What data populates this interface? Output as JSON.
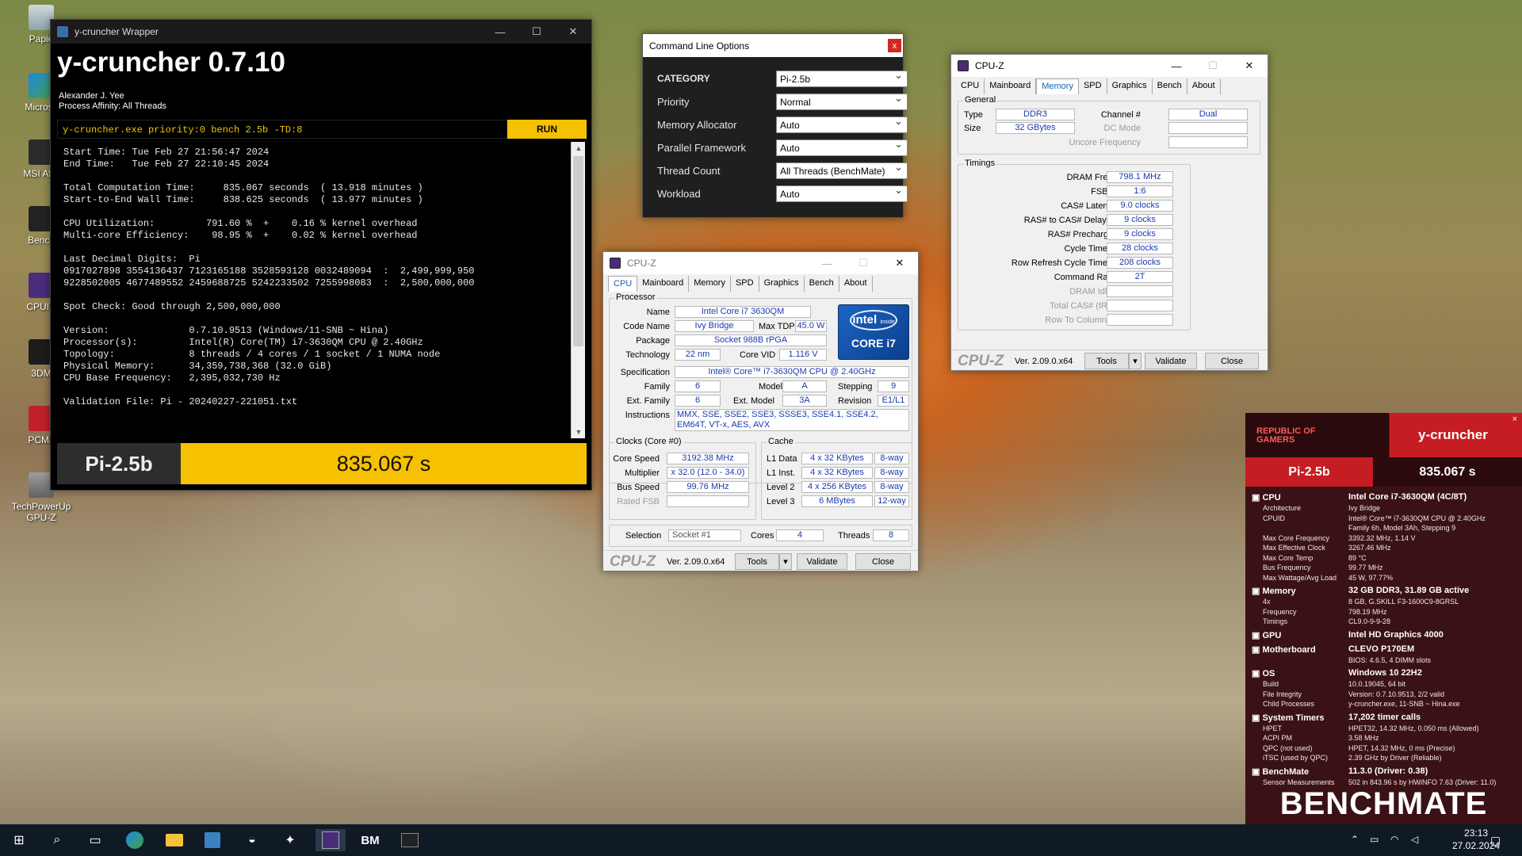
{
  "desktop": {
    "icons": [
      {
        "label": "Papie"
      },
      {
        "label": "Microsc"
      },
      {
        "label": "MSI Afte"
      },
      {
        "label": "Bench"
      },
      {
        "label": "CPUID"
      },
      {
        "label": "3DM"
      },
      {
        "label": "PCMa"
      },
      {
        "label": "TechPowerUp GPU-Z"
      }
    ]
  },
  "ycruncher": {
    "window_title": "y-cruncher Wrapper",
    "title": "y-cruncher 0.7.10",
    "author": "Alexander J. Yee",
    "affinity": "Process Affinity: All Threads",
    "command": "y-cruncher.exe priority:0 bench 2.5b -TD:8",
    "run_label": "RUN",
    "output": [
      "Start Time: Tue Feb 27 21:56:47 2024",
      "End Time:   Tue Feb 27 22:10:45 2024",
      "",
      "Total Computation Time:     835.067 seconds  ( 13.918 minutes )",
      "Start-to-End Wall Time:     838.625 seconds  ( 13.977 minutes )",
      "",
      "CPU Utilization:         791.60 %  +    0.16 % kernel overhead",
      "Multi-core Efficiency:    98.95 %  +    0.02 % kernel overhead",
      "",
      "Last Decimal Digits:  Pi",
      "0917027898 3554136437 7123165188 3528593128 0032489094  :  2,499,999,950",
      "9228502005 4677489552 2459688725 5242233502 7255998083  :  2,500,000,000",
      "",
      "Spot Check: Good through 2,500,000,000",
      "",
      "Version:              0.7.10.9513 (Windows/11-SNB ~ Hina)",
      "Processor(s):         Intel(R) Core(TM) i7-3630QM CPU @ 2.40GHz",
      "Topology:             8 threads / 4 cores / 1 socket / 1 NUMA node",
      "Physical Memory:      34,359,738,368 (32.0 GiB)",
      "CPU Base Frequency:   2,395,032,730 Hz",
      "",
      "Validation File: Pi - 20240227-221051.txt"
    ],
    "result_label": "Pi-2.5b",
    "result_value": "835.067 s"
  },
  "clo": {
    "title": "Command Line Options",
    "rows": [
      {
        "label": "CATEGORY",
        "value": "Pi-2.5b"
      },
      {
        "label": "Priority",
        "value": "Normal"
      },
      {
        "label": "Memory Allocator",
        "value": "Auto"
      },
      {
        "label": "Parallel Framework",
        "value": "Auto"
      },
      {
        "label": "Thread Count",
        "value": "All Threads (BenchMate)"
      },
      {
        "label": "Workload",
        "value": "Auto"
      }
    ]
  },
  "cpuz_common": {
    "title": "CPU-Z",
    "tabs": [
      "CPU",
      "Mainboard",
      "Memory",
      "SPD",
      "Graphics",
      "Bench",
      "About"
    ],
    "logo": "CPU-Z",
    "version": "Ver. 2.09.0.x64",
    "tools": "Tools",
    "validate": "Validate",
    "close": "Close"
  },
  "cpuz_cpu": {
    "processor_group": "Processor",
    "name_label": "Name",
    "name": "Intel Core i7 3630QM",
    "codename_label": "Code Name",
    "codename": "Ivy Bridge",
    "maxtdp_label": "Max TDP",
    "maxtdp": "45.0 W",
    "package_label": "Package",
    "package": "Socket 988B rPGA",
    "tech_label": "Technology",
    "tech": "22 nm",
    "vid_label": "Core VID",
    "vid": "1.116 V",
    "spec_label": "Specification",
    "spec": "Intel® Core™ i7-3630QM CPU @ 2.40GHz",
    "family_label": "Family",
    "family": "6",
    "model_label": "Model",
    "model": "A",
    "stepping_label": "Stepping",
    "stepping": "9",
    "extfamily_label": "Ext. Family",
    "extfamily": "6",
    "extmodel_label": "Ext. Model",
    "extmodel": "3A",
    "revision_label": "Revision",
    "revision": "E1/L1",
    "instr_label": "Instructions",
    "instructions": "MMX, SSE, SSE2, SSE3, SSSE3, SSE4.1, SSE4.2, EM64T, VT-x, AES, AVX",
    "intel_inside": "intel",
    "intel_inside2": "inside",
    "core_i7": "CORE i7",
    "clocks_group": "Clocks (Core #0)",
    "corespeed_label": "Core Speed",
    "corespeed": "3192.38 MHz",
    "mult_label": "Multiplier",
    "mult": "x 32.0 (12.0 - 34.0)",
    "bus_label": "Bus Speed",
    "bus": "99.76 MHz",
    "fsb_label": "Rated FSB",
    "fsb": "",
    "cache_group": "Cache",
    "l1d_label": "L1 Data",
    "l1d": "4 x 32 KBytes",
    "l1d_way": "8-way",
    "l1i_label": "L1 Inst.",
    "l1i": "4 x 32 KBytes",
    "l1i_way": "8-way",
    "l2_label": "Level 2",
    "l2": "4 x 256 KBytes",
    "l2_way": "8-way",
    "l3_label": "Level 3",
    "l3": "6 MBytes",
    "l3_way": "12-way",
    "selection_label": "Selection",
    "selection": "Socket #1",
    "cores_label": "Cores",
    "cores": "4",
    "threads_label": "Threads",
    "threads": "8"
  },
  "cpuz_mem": {
    "general_group": "General",
    "type_label": "Type",
    "type": "DDR3",
    "size_label": "Size",
    "size": "32 GBytes",
    "channel_label": "Channel #",
    "channel": "Dual",
    "dcmode_label": "DC Mode",
    "uncore_label": "Uncore Frequency",
    "timings_group": "Timings",
    "timings": [
      {
        "label": "DRAM Frequency",
        "value": "798.1 MHz"
      },
      {
        "label": "FSB:DRAM",
        "value": "1:6"
      },
      {
        "label": "CAS# Latency (CL)",
        "value": "9.0 clocks"
      },
      {
        "label": "RAS# to CAS# Delay (tRCD)",
        "value": "9 clocks"
      },
      {
        "label": "RAS# Precharge (tRP)",
        "value": "9 clocks"
      },
      {
        "label": "Cycle Time (tRAS)",
        "value": "28 clocks"
      },
      {
        "label": "Row Refresh Cycle Time (tRFC)",
        "value": "208 clocks"
      },
      {
        "label": "Command Rate (CR)",
        "value": "2T"
      }
    ],
    "dim_timings": [
      "DRAM Idle Timer",
      "Total CAS# (tRDRAM)",
      "Row To Column (tRCD)"
    ]
  },
  "benchmate": {
    "rog": "REPUBLIC OF",
    "rog2": "GAMERS",
    "app": "y-cruncher",
    "close": "×",
    "result_label": "Pi-2.5b",
    "result_value": "835.067 s",
    "sections": [
      {
        "title": "CPU",
        "value": "Intel Core i7-3630QM (4C/8T)",
        "rows": [
          {
            "k": "Architecture",
            "v": "Ivy Bridge"
          },
          {
            "k": "CPUID",
            "v": "Intel® Core™ i7-3630QM CPU @ 2.40GHz"
          },
          {
            "k": "",
            "v": "Family 6h, Model 3Ah, Stepping 9"
          },
          {
            "k": "Max Core Frequency",
            "v": "3392.32 MHz, 1.14 V"
          },
          {
            "k": "Max Effective Clock",
            "v": "3267.46 MHz"
          },
          {
            "k": "Max Core Temp",
            "v": "89 °C"
          },
          {
            "k": "Bus Frequency",
            "v": "99.77 MHz"
          },
          {
            "k": "Max Wattage/Avg Load",
            "v": "45 W, 97.77%"
          }
        ]
      },
      {
        "title": "Memory",
        "value": "32 GB DDR3, 31.89 GB active",
        "rows": [
          {
            "k": "4x",
            "v": "8 GB, G.SKILL F3-1600C9-8GRSL"
          },
          {
            "k": "Frequency",
            "v": "798.19 MHz"
          },
          {
            "k": "Timings",
            "v": "CL9.0-9-9-28"
          }
        ]
      },
      {
        "title": "GPU",
        "value": "Intel HD Graphics 4000",
        "rows": []
      },
      {
        "title": "Motherboard",
        "value": "CLEVO P170EM",
        "rows": [
          {
            "k": "",
            "v": "BIOS: 4.6.5, 4 DIMM slots"
          }
        ]
      },
      {
        "title": "OS",
        "value": "Windows 10 22H2",
        "rows": [
          {
            "k": "Build",
            "v": "10.0.19045, 64 bit"
          },
          {
            "k": "File Integrity",
            "v": "Version: 0.7.10.9513, 2/2 valid"
          },
          {
            "k": "Child Processes",
            "v": "y-cruncher.exe, 11-SNB ~ Hina.exe"
          }
        ]
      },
      {
        "title": "System Timers",
        "value": "17,202 timer calls",
        "rows": [
          {
            "k": "HPET",
            "v": "HPET32, 14.32 MHz, 0.050 ms (Allowed)"
          },
          {
            "k": "ACPI PM",
            "v": "3.58 MHz"
          },
          {
            "k": "QPC (not used)",
            "v": "HPET, 14.32 MHz, 0 ms (Precise)"
          },
          {
            "k": "iTSC (used by QPC)",
            "v": "2.39 GHz by Driver (Reliable)"
          }
        ]
      },
      {
        "title": "BenchMate",
        "value": "11.3.0 (Driver: 0.38)",
        "rows": [
          {
            "k": "Sensor Measurements",
            "v": "502 in 843.96 s by HWiNFO 7.63 (Driver: 11.0)"
          }
        ]
      }
    ],
    "logo": "BENCHMATE"
  },
  "taskbar": {
    "time": "23:13",
    "date": "27.02.2024",
    "bm_label": "BM"
  }
}
